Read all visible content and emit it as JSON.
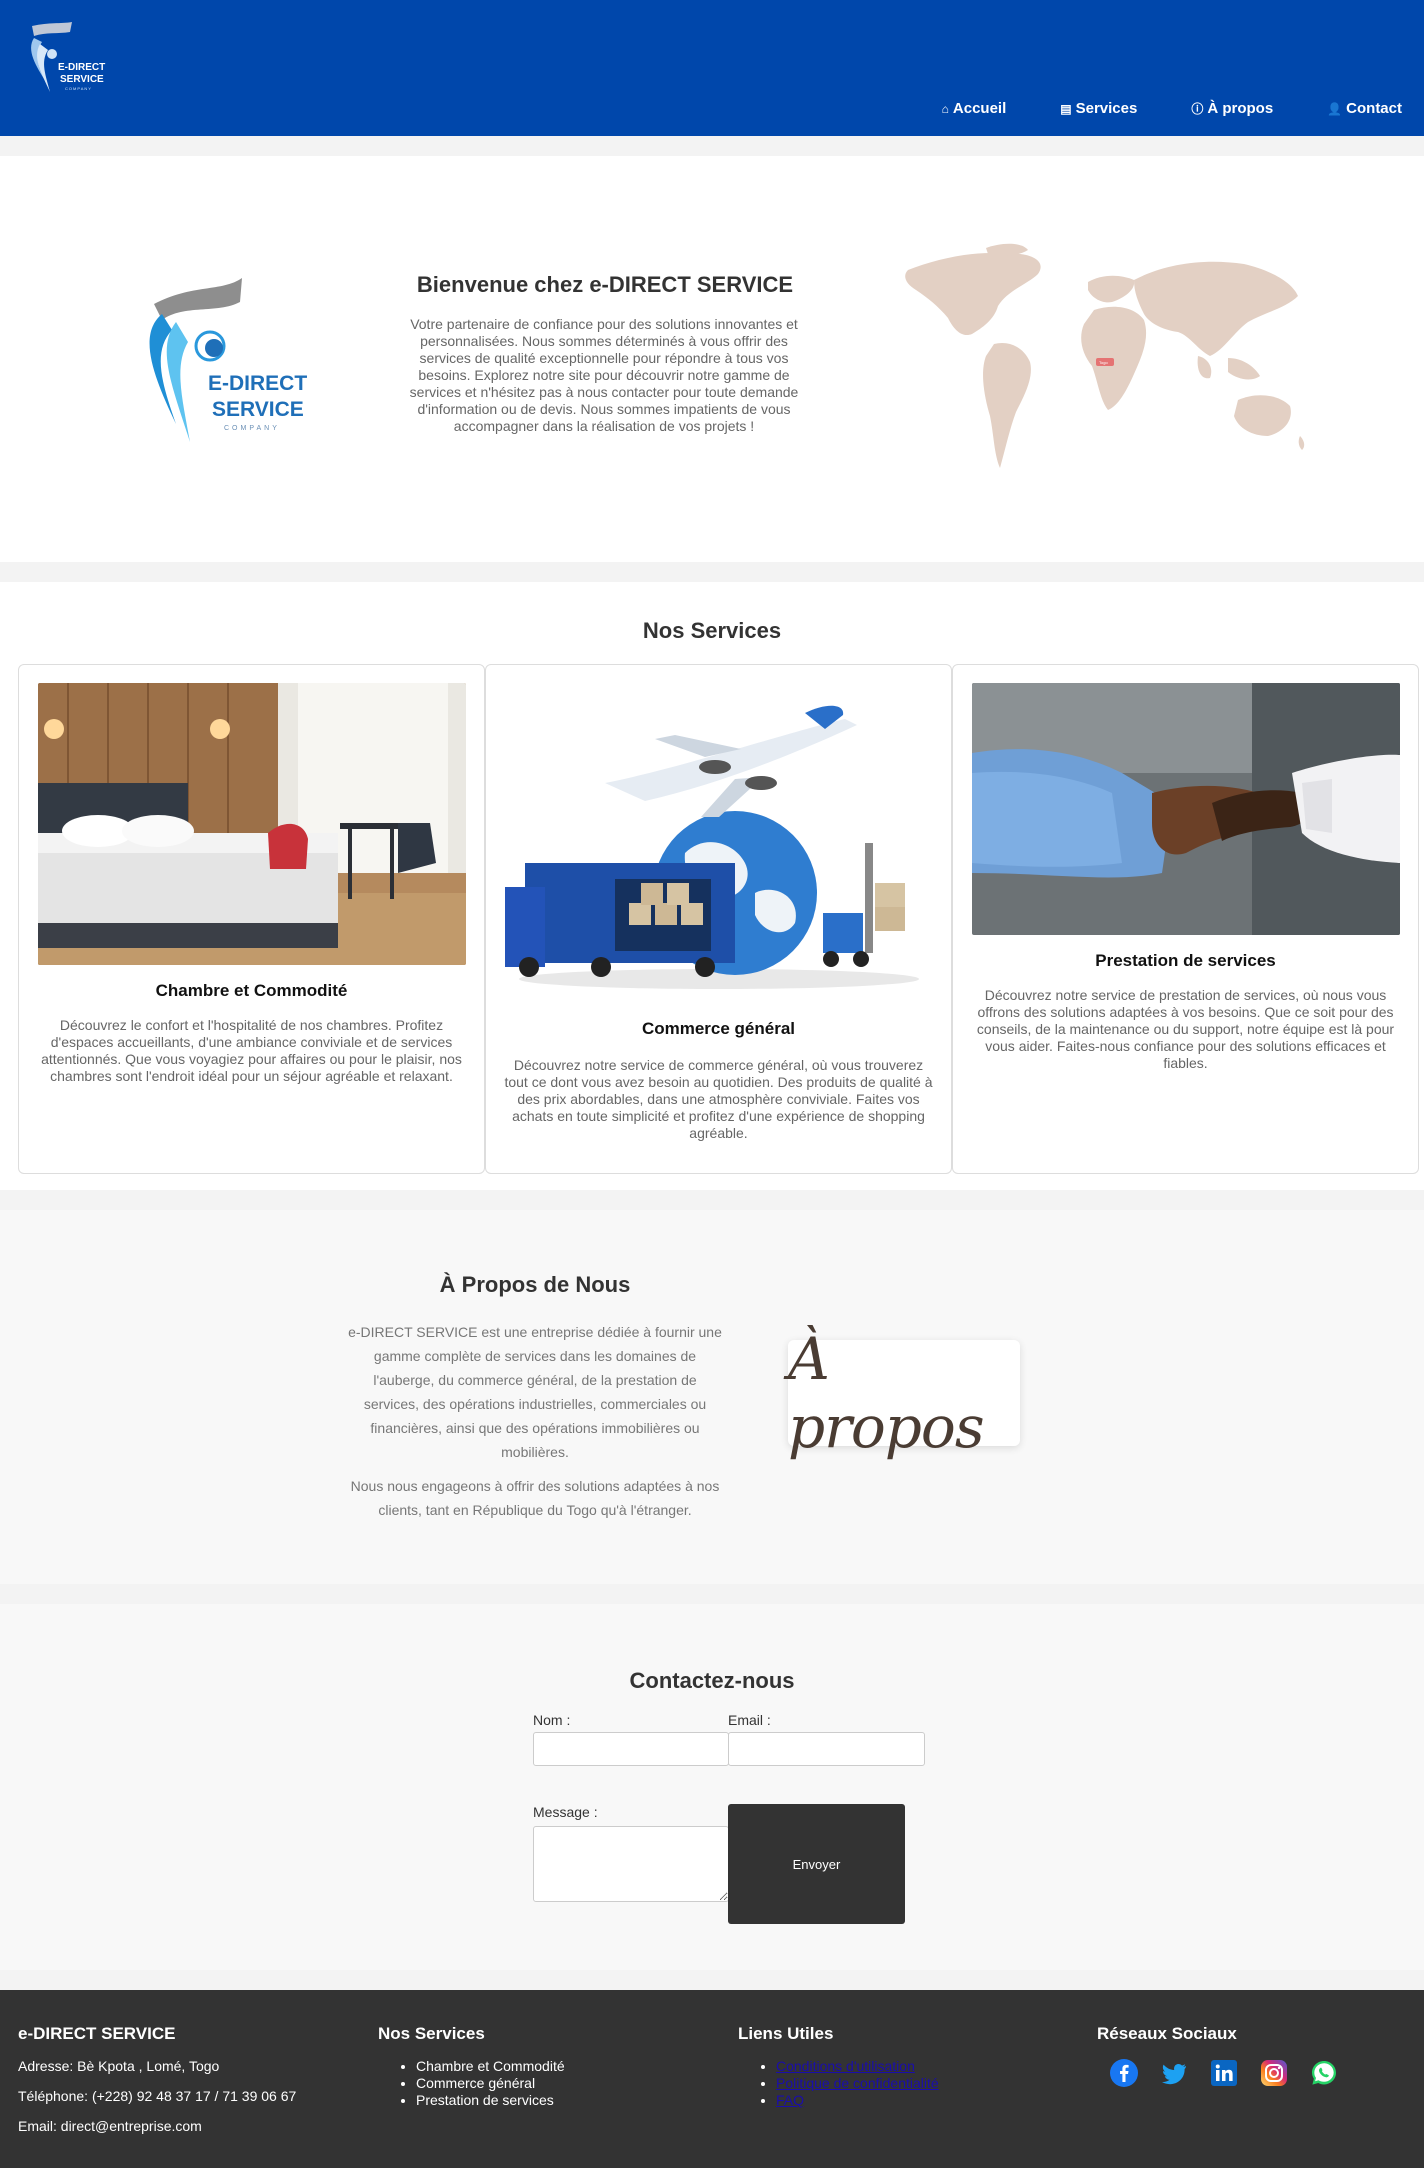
{
  "header": {
    "logo_text": [
      "E-DIRECT",
      "SERVICE",
      "COMPANY"
    ],
    "nav": [
      {
        "label": "Accueil",
        "icon": "home-icon"
      },
      {
        "label": "Services",
        "icon": "services-icon"
      },
      {
        "label": "À propos",
        "icon": "info-icon"
      },
      {
        "label": "Contact",
        "icon": "contact-icon"
      }
    ],
    "bg_color": "#0047ab"
  },
  "hero": {
    "logo_text": [
      "E-DIRECT",
      "SERVICE",
      "COMPANY"
    ],
    "title": "Bienvenue chez e-DIRECT SERVICE",
    "text": "Votre partenaire de confiance pour des solutions innovantes et personnalisées. Nous sommes déterminés à vous offrir des services de qualité exceptionnelle pour répondre à tous vos besoins. Explorez notre site pour découvrir notre gamme de services et n'hésitez pas à nous contacter pour toute demande d'information ou de devis. Nous sommes impatients de vous accompagner dans la réalisation de vos projets !",
    "map_marker_label": "Togo"
  },
  "services": {
    "title": "Nos Services",
    "cards": [
      {
        "title": "Chambre et Commodité",
        "text": "Découvrez le confort et l'hospitalité de nos chambres. Profitez d'espaces accueillants, d'une ambiance conviviale et de services attentionnés. Que vous voyagiez pour affaires ou pour le plaisir, nos chambres sont l'endroit idéal pour un séjour agréable et relaxant."
      },
      {
        "title": "Commerce général",
        "text": "Découvrez notre service de commerce général, où vous trouverez tout ce dont vous avez besoin au quotidien. Des produits de qualité à des prix abordables, dans une atmosphère conviviale. Faites vos achats en toute simplicité et profitez d'une expérience de shopping agréable."
      },
      {
        "title": "Prestation de services",
        "text": "Découvrez notre service de prestation de services, où nous vous offrons des solutions adaptées à vos besoins. Que ce soit pour des conseils, de la maintenance ou du support, notre équipe est là pour vous aider. Faites-nous confiance pour des solutions efficaces et fiables."
      }
    ]
  },
  "about": {
    "title": "À Propos de Nous",
    "p1": "e-DIRECT SERVICE est une entreprise dédiée à fournir une gamme complète de services dans les domaines de l'auberge, du commerce général, de la prestation de services, des opérations industrielles, commerciales ou financières, ainsi que des opérations immobilières ou mobilières.",
    "p2": "Nous nous engageons à offrir des solutions adaptées à nos clients, tant en République du Togo qu'à l'étranger.",
    "image_text": "À propos"
  },
  "contact": {
    "title": "Contactez-nous",
    "name_label": "Nom :",
    "email_label": "Email :",
    "message_label": "Message :",
    "submit_label": "Envoyer"
  },
  "footer": {
    "company": {
      "title": "e-DIRECT SERVICE",
      "address": "Adresse: Bè Kpota , Lomé, Togo",
      "phone": "Téléphone: (+228) 92 48 37 17 / 71 39 06 67",
      "email": "Email: direct@entreprise.com"
    },
    "services": {
      "title": "Nos Services",
      "items": [
        "Chambre et Commodité",
        "Commerce général",
        "Prestation de services"
      ]
    },
    "links": {
      "title": "Liens Utiles",
      "items": [
        "Conditions d'utilisation",
        "Politique de confidentialité",
        "FAQ"
      ]
    },
    "social": {
      "title": "Réseaux Sociaux",
      "icons": [
        "facebook-icon",
        "twitter-icon",
        "linkedin-icon",
        "instagram-icon",
        "whatsapp-icon"
      ]
    }
  }
}
